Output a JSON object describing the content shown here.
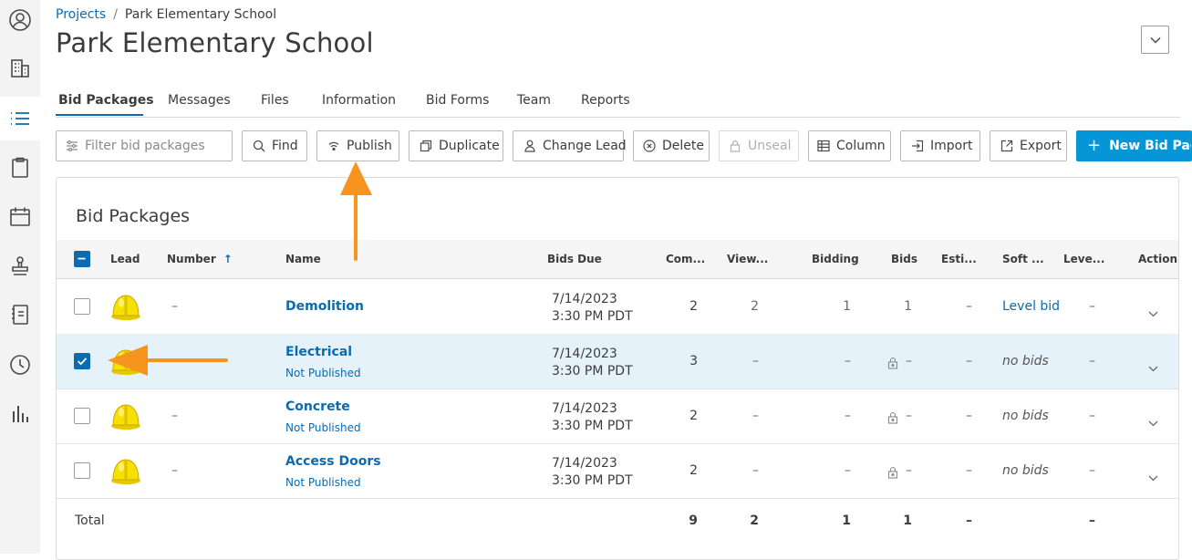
{
  "rail": {
    "icons": [
      "user-circle-icon",
      "building-icon",
      "list-icon",
      "clipboard-icon",
      "calendar-icon",
      "stamp-icon",
      "notebook-icon",
      "clock-icon",
      "bar-chart-icon"
    ],
    "active": "list-icon"
  },
  "breadcrumb": {
    "root": "Projects",
    "separator": "/",
    "current": "Park Elementary School"
  },
  "title": "Park Elementary School",
  "tabs": [
    {
      "label": "Bid Packages",
      "active": true
    },
    {
      "label": "Messages"
    },
    {
      "label": "Files"
    },
    {
      "label": "Information"
    },
    {
      "label": "Bid Forms"
    },
    {
      "label": "Team"
    },
    {
      "label": "Reports"
    }
  ],
  "toolbar": {
    "search_placeholder": "Filter bid packages",
    "find": "Find",
    "publish": "Publish",
    "duplicate": "Duplicate",
    "change_lead": "Change Lead",
    "delete": "Delete",
    "unseal": "Unseal",
    "column": "Column",
    "import": "Import",
    "export": "Export",
    "new_bid_package": "New Bid Packa"
  },
  "table": {
    "title": "Bid Packages",
    "headers": {
      "lead": "Lead",
      "number": "Number",
      "name": "Name",
      "bids_due": "Bids Due",
      "com": "Com...",
      "view": "View...",
      "bidding": "Bidding",
      "bids": "Bids",
      "esti": "Esti...",
      "soft": "Soft ...",
      "leve": "Leve...",
      "action": "Action"
    },
    "rows": [
      {
        "number": "–",
        "name": "Demolition",
        "status": "",
        "date": "7/14/2023",
        "time": "3:30 PM PDT",
        "com": "2",
        "view": "2",
        "bidding": "1",
        "bids": "1",
        "esti": "–",
        "soft": "Level bid",
        "leve": "–",
        "selected": false
      },
      {
        "number": "",
        "name": "Electrical",
        "status": "Not Published",
        "date": "7/14/2023",
        "time": "3:30 PM PDT",
        "com": "3",
        "view": "–",
        "bidding": "–",
        "bids": "–",
        "esti": "–",
        "soft": "no bids",
        "leve": "–",
        "selected": true
      },
      {
        "number": "–",
        "name": "Concrete",
        "status": "Not Published",
        "date": "7/14/2023",
        "time": "3:30 PM PDT",
        "com": "2",
        "view": "–",
        "bidding": "–",
        "bids": "–",
        "esti": "–",
        "soft": "no bids",
        "leve": "–",
        "selected": false
      },
      {
        "number": "–",
        "name": "Access Doors",
        "status": "Not Published",
        "date": "7/14/2023",
        "time": "3:30 PM PDT",
        "com": "2",
        "view": "–",
        "bidding": "–",
        "bids": "–",
        "esti": "–",
        "soft": "no bids",
        "leve": "–",
        "selected": false
      }
    ],
    "total": {
      "label": "Total",
      "com": "9",
      "view": "2",
      "bidding": "1",
      "bids": "1",
      "esti": "–",
      "leve": "–"
    }
  },
  "colors": {
    "accent": "#0a6ab2",
    "primary_button": "#0696d7",
    "annotation_arrow": "#f7941d",
    "selected_row": "#e5f2fa"
  }
}
